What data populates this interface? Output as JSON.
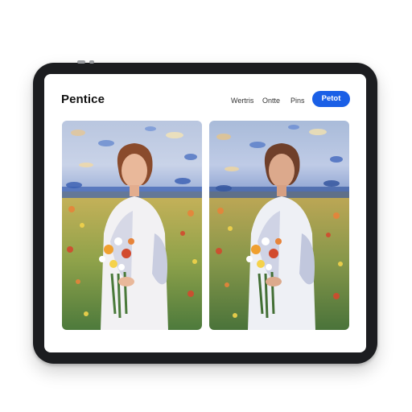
{
  "header": {
    "brand": "Pentice",
    "nav": [
      "Wertris",
      "Ontte",
      "Pins"
    ],
    "cta": "Petot"
  },
  "gallery": {
    "images": [
      {
        "name": "woman-with-flowers-painting-left"
      },
      {
        "name": "woman-with-flowers-painting-right"
      }
    ]
  },
  "colors": {
    "accent": "#1a5fe6",
    "device_frame": "#1c1d20"
  }
}
